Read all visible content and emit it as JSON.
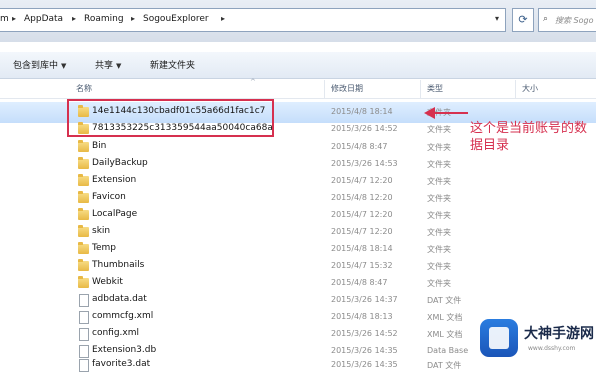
{
  "address_bar": {
    "crumbs": [
      "m",
      "AppData",
      "Roaming",
      "SogouExplorer"
    ],
    "search_placeholder": "搜索 Sogo"
  },
  "toolbar": {
    "include_in_library": "包含到库中",
    "share": "共享",
    "new_folder": "新建文件夹"
  },
  "columns": {
    "name": "名称",
    "date": "修改日期",
    "type": "类型",
    "size": "大小"
  },
  "files": [
    {
      "name": "14e1144c130cbadf01c55a66d1fac1c7",
      "date": "2015/4/8 18:14",
      "type": "文件夹",
      "kind": "folder",
      "selected": true
    },
    {
      "name": "7813353225c313359544aa50040ca68a",
      "date": "2015/3/26 14:52",
      "type": "文件夹",
      "kind": "folder"
    },
    {
      "name": "Bin",
      "date": "2015/4/8 8:47",
      "type": "文件夹",
      "kind": "folder"
    },
    {
      "name": "DailyBackup",
      "date": "2015/3/26 14:53",
      "type": "文件夹",
      "kind": "folder"
    },
    {
      "name": "Extension",
      "date": "2015/4/7 12:20",
      "type": "文件夹",
      "kind": "folder"
    },
    {
      "name": "Favicon",
      "date": "2015/4/8 12:20",
      "type": "文件夹",
      "kind": "folder"
    },
    {
      "name": "LocalPage",
      "date": "2015/4/7 12:20",
      "type": "文件夹",
      "kind": "folder"
    },
    {
      "name": "skin",
      "date": "2015/4/7 12:20",
      "type": "文件夹",
      "kind": "folder"
    },
    {
      "name": "Temp",
      "date": "2015/4/8 18:14",
      "type": "文件夹",
      "kind": "folder"
    },
    {
      "name": "Thumbnails",
      "date": "2015/4/7 15:32",
      "type": "文件夹",
      "kind": "folder"
    },
    {
      "name": "Webkit",
      "date": "2015/4/8 8:47",
      "type": "文件夹",
      "kind": "folder"
    },
    {
      "name": "adbdata.dat",
      "date": "2015/3/26 14:37",
      "type": "DAT 文件",
      "kind": "file"
    },
    {
      "name": "commcfg.xml",
      "date": "2015/4/8 18:13",
      "type": "XML 文档",
      "kind": "file"
    },
    {
      "name": "config.xml",
      "date": "2015/3/26 14:52",
      "type": "XML 文档",
      "kind": "file"
    },
    {
      "name": "Extension3.db",
      "date": "2015/3/26 14:35",
      "type": "Data Base",
      "kind": "file"
    },
    {
      "name": "favorite3.dat",
      "date": "2015/3/26 14:35",
      "type": "DAT 文件",
      "kind": "file"
    }
  ],
  "annotation": {
    "note": "这个是当前账号的数据目录"
  },
  "watermark": {
    "title": "大神手游网",
    "url": "www.dsshy.com"
  }
}
